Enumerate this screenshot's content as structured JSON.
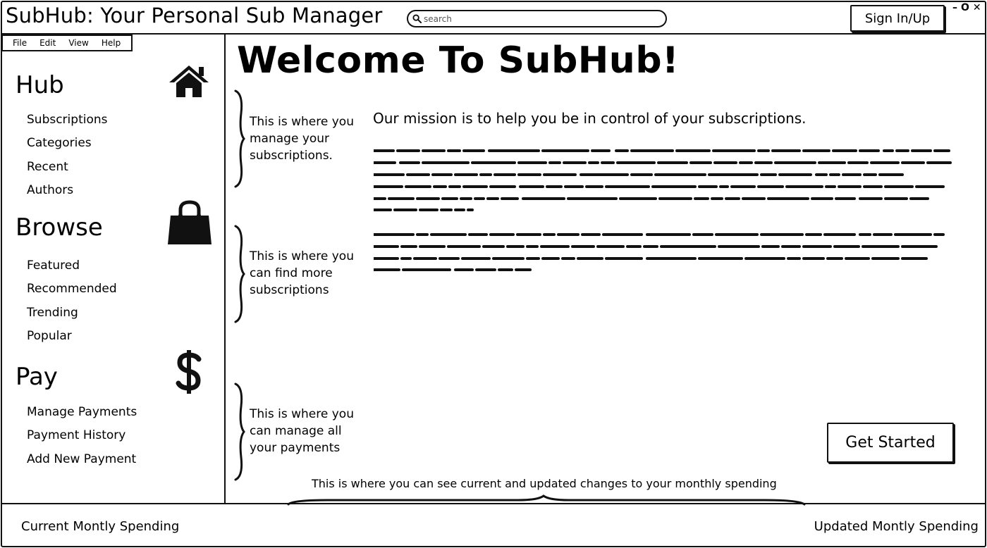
{
  "header": {
    "app_title": "SubHub: Your Personal Sub Manager",
    "search_placeholder": "search",
    "signin_label": "Sign In/Up",
    "window_controls": {
      "minimize": "–",
      "maximize": "O",
      "close": "✕"
    }
  },
  "menubar": {
    "items": [
      {
        "label": "File"
      },
      {
        "label": "Edit"
      },
      {
        "label": "View"
      },
      {
        "label": "Help"
      }
    ]
  },
  "sidebar": {
    "sections": [
      {
        "title": "Hub",
        "icon": "home-icon",
        "items": [
          {
            "label": "Subscriptions"
          },
          {
            "label": "Categories"
          },
          {
            "label": "Recent"
          },
          {
            "label": "Authors"
          }
        ]
      },
      {
        "title": "Browse",
        "icon": "shopping-bag-icon",
        "items": [
          {
            "label": "Featured"
          },
          {
            "label": "Recommended"
          },
          {
            "label": "Trending"
          },
          {
            "label": "Popular"
          }
        ]
      },
      {
        "title": "Pay",
        "icon": "dollar-icon",
        "items": [
          {
            "label": "Manage Payments"
          },
          {
            "label": "Payment History"
          },
          {
            "label": "Add New Payment"
          }
        ]
      }
    ]
  },
  "main": {
    "welcome_title": "Welcome To SubHub!",
    "mission": "Our mission is to help you be in control of your subscriptions.",
    "notes": [
      "This is where you manage your subscriptions.",
      "This is where you can find more subscriptions",
      "This is where you can manage all your payments"
    ],
    "get_started_label": "Get Started",
    "spending_note": "This is where you can see current and updated changes to your monthly spending"
  },
  "footer": {
    "current_spending": "Current Montly Spending",
    "updated_spending": "Updated Montly Spending"
  },
  "colors": {
    "ink": "#111111",
    "background": "#ffffff"
  }
}
